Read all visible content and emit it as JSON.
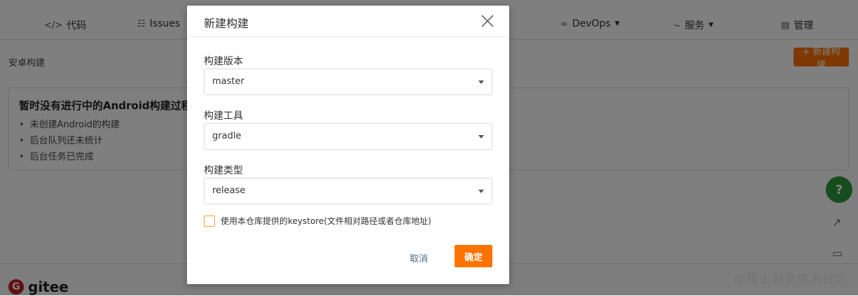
{
  "nav": {
    "items": [
      {
        "icon": "code-icon",
        "glyph": "</>",
        "label": "代码"
      },
      {
        "icon": "issues-icon",
        "glyph": "☷",
        "label": "Issues"
      },
      {
        "icon": "devops-icon",
        "glyph": "∞",
        "label": "DevOps"
      },
      {
        "icon": "pulse-icon",
        "glyph": "⏦",
        "label": "服务"
      },
      {
        "icon": "manage-icon",
        "glyph": "▤",
        "label": "管理"
      }
    ]
  },
  "breadcrumb": "安卓构建",
  "new_build_button": "+ 新建构建",
  "empty_state": {
    "title": "暂时没有进行中的Android构建过程",
    "items": [
      "未创建Android的构建",
      "后台队列还未统计",
      "后台任务已完成"
    ]
  },
  "footer": {
    "brand": "gitee",
    "brand_mark": "G"
  },
  "help_label": "?",
  "watermark": "@稀土掘金技术社区",
  "modal": {
    "title": "新建构建",
    "fields": [
      {
        "label": "构建版本",
        "value": "master"
      },
      {
        "label": "构建工具",
        "value": "gradle"
      },
      {
        "label": "构建类型",
        "value": "release"
      }
    ],
    "keystore_label": "使用本仓库提供的keystore(文件相对路径或者仓库地址)",
    "keystore_checked": false,
    "cancel_label": "取消",
    "confirm_label": "确定"
  },
  "colors": {
    "accent": "#fe7300",
    "help": "#2e9b3c",
    "brand": "#c71d23"
  }
}
